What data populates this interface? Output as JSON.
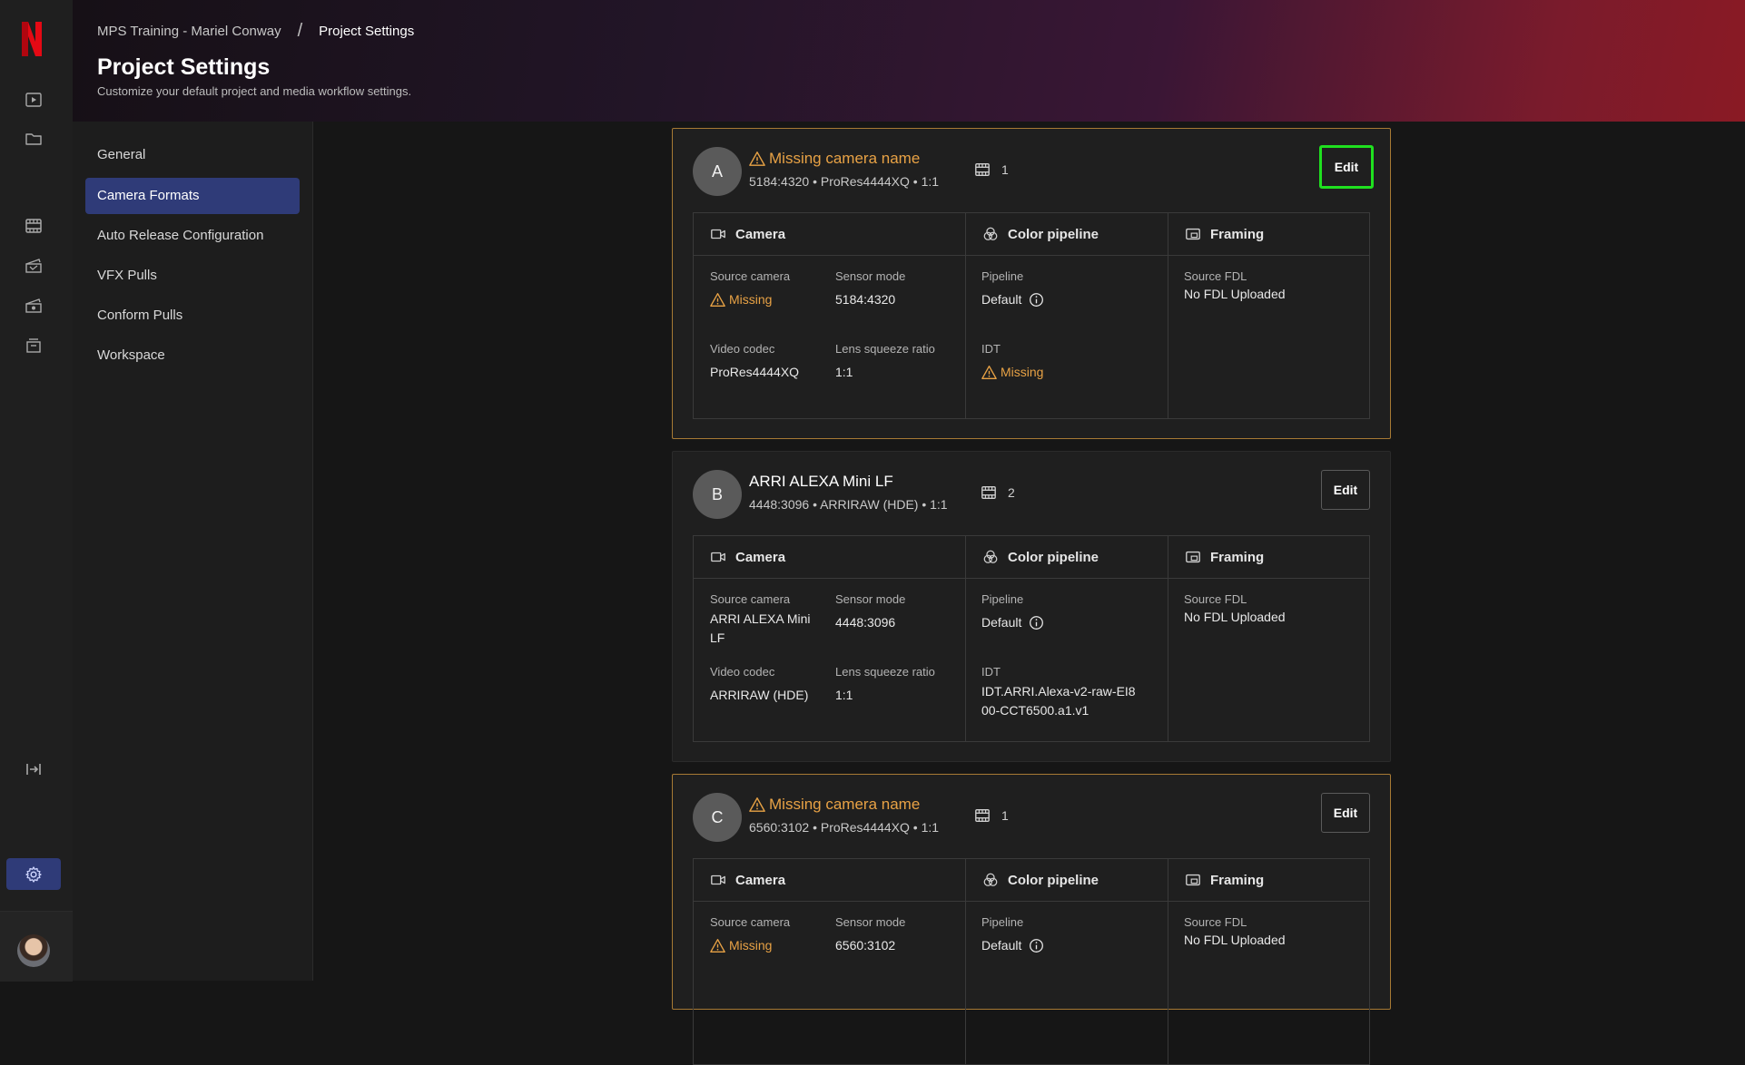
{
  "breadcrumb": {
    "parent": "MPS Training - Mariel Conway",
    "separator": "/",
    "current": "Project Settings"
  },
  "header": {
    "title": "Project Settings",
    "subtitle": "Customize your default project and media workflow settings."
  },
  "rail": {
    "icons": [
      "netflix-logo",
      "play-icon",
      "folder-icon",
      "film-icon",
      "clapper-icon",
      "clapper-alt-icon",
      "archive-icon",
      "collapse-icon",
      "gear-icon",
      "avatar"
    ]
  },
  "nav": [
    {
      "label": "General",
      "active": false
    },
    {
      "label": "Camera Formats",
      "active": true
    },
    {
      "label": "Auto Release Configuration",
      "active": false
    },
    {
      "label": "VFX Pulls",
      "active": false
    },
    {
      "label": "Conform Pulls",
      "active": false
    },
    {
      "label": "Workspace",
      "active": false
    }
  ],
  "labels": {
    "edit": "Edit",
    "camera": "Camera",
    "color_pipeline": "Color pipeline",
    "framing": "Framing",
    "source_camera": "Source camera",
    "sensor_mode": "Sensor mode",
    "video_codec": "Video codec",
    "lens_squeeze": "Lens squeeze ratio",
    "pipeline": "Pipeline",
    "idt": "IDT",
    "source_fdl": "Source FDL"
  },
  "cards": [
    {
      "badge": "A",
      "name": "Missing camera name",
      "missing": true,
      "meta": "5184:4320 • ProRes4444XQ • 1:1",
      "clip_count": "1",
      "source_camera": "Missing",
      "sensor_mode": "5184:4320",
      "video_codec": "ProRes4444XQ",
      "lens_squeeze": "1:1",
      "pipeline": "Default",
      "idt": "Missing",
      "source_fdl": "No FDL Uploaded"
    },
    {
      "badge": "B",
      "name": "ARRI ALEXA Mini LF",
      "missing": false,
      "meta": "4448:3096 • ARRIRAW (HDE) • 1:1",
      "clip_count": "2",
      "source_camera": "ARRI ALEXA Mini LF",
      "sensor_mode": "4448:3096",
      "video_codec": "ARRIRAW (HDE)",
      "lens_squeeze": "1:1",
      "pipeline": "Default",
      "idt": "IDT.ARRI.Alexa-v2-raw-EI800-CCT6500.a1.v1",
      "source_fdl": "No FDL Uploaded"
    },
    {
      "badge": "C",
      "name": "Missing camera name",
      "missing": true,
      "meta": "6560:3102 • ProRes4444XQ • 1:1",
      "clip_count": "1",
      "source_camera": "Missing",
      "sensor_mode": "6560:3102",
      "pipeline": "Default",
      "source_fdl": "No FDL Uploaded"
    }
  ],
  "colors": {
    "accent": "#2f3b78",
    "warning": "#e8a245",
    "focus": "#1fe01f"
  }
}
